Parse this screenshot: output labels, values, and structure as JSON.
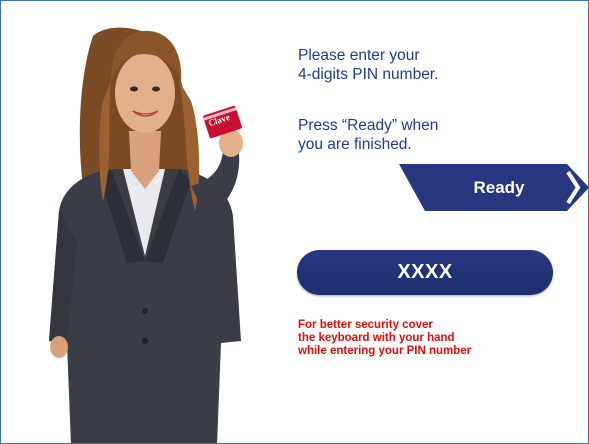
{
  "instructions": {
    "line1": "Please enter your",
    "line2": "4-digits PIN number.",
    "line3": "Press “Ready” when",
    "line4": "you are finished."
  },
  "ready_button": {
    "label": "Ready"
  },
  "pin_field": {
    "value": "XXXX"
  },
  "warning": {
    "line1": "For better security cover",
    "line2": "the keyboard with your hand",
    "line3": "while entering your PIN number"
  },
  "card": {
    "logo_text": "Clave"
  },
  "colors": {
    "primary_navy": "#1f3a93",
    "button_navy": "#26377f",
    "warning_red": "#e10d0d",
    "frame_blue": "#3c73b8"
  }
}
